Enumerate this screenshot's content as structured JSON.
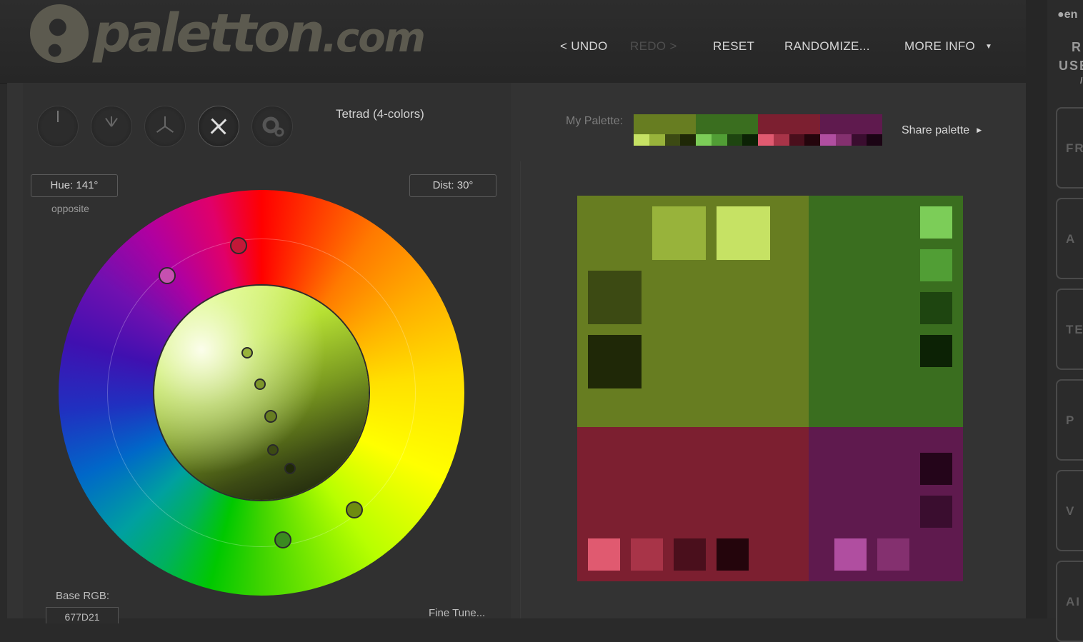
{
  "header": {
    "logo_text": "paletton",
    "logo_suffix": ".com",
    "nav": {
      "undo": "< UNDO",
      "redo": "REDO >",
      "reset": "RESET",
      "randomize": "RANDOMIZE...",
      "more_info": "MORE INFO"
    }
  },
  "scheme": {
    "title": "Tetrad (4-colors)",
    "buttons": [
      "mono-icon",
      "adjacent-icon",
      "triad-icon",
      "tetrad-icon",
      "freestyle-gear-icon"
    ],
    "active": "tetrad-icon"
  },
  "wheel": {
    "hue_label": "Hue: 141°",
    "hue_sublabel": "opposite",
    "dist_label": "Dist: 30°",
    "base_rgb_label": "Base RGB:",
    "base_rgb_value": "677D21",
    "fine_tune": "Fine Tune..."
  },
  "my_palette": {
    "label": "My Palette:",
    "share": "Share palette",
    "colors": [
      {
        "main": "#677d21",
        "shades": [
          "#c6e264",
          "#98b33b",
          "#3c4a13",
          "#1f2807"
        ]
      },
      {
        "main": "#3a6e1f",
        "shades": [
          "#7ccd58",
          "#519e35",
          "#1e4510",
          "#0c2205"
        ]
      },
      {
        "main": "#7c1f30",
        "shades": [
          "#e05a70",
          "#a83448",
          "#4a0f1c",
          "#24050c"
        ]
      },
      {
        "main": "#5f1a4e",
        "shades": [
          "#b04ea0",
          "#84306f",
          "#3a0d2f",
          "#1b0414"
        ]
      }
    ]
  },
  "preview": {
    "tl": {
      "main": "#677d21",
      "shades": [
        "#98b33b",
        "#c6e264",
        "#3c4a13",
        "#1f2807"
      ]
    },
    "tr": {
      "main": "#3a6e1f",
      "shades": [
        "#7ccd58",
        "#519e35",
        "#1e4510",
        "#0c2205"
      ]
    },
    "bl": {
      "main": "#7c1f30",
      "shades": [
        "#e05a70",
        "#a83448",
        "#4a0f1c",
        "#24050c"
      ]
    },
    "br": {
      "main": "#5f1a4e",
      "shades": [
        "#24051a",
        "#3a0d2f",
        "#b04ea0",
        "#84306f"
      ]
    }
  },
  "sidebar": {
    "lang": "en",
    "title_1": "R",
    "title_2": "USE",
    "title_3": "/",
    "tabs": [
      "FR",
      "A",
      "TE",
      "P",
      "V",
      "AI"
    ]
  }
}
